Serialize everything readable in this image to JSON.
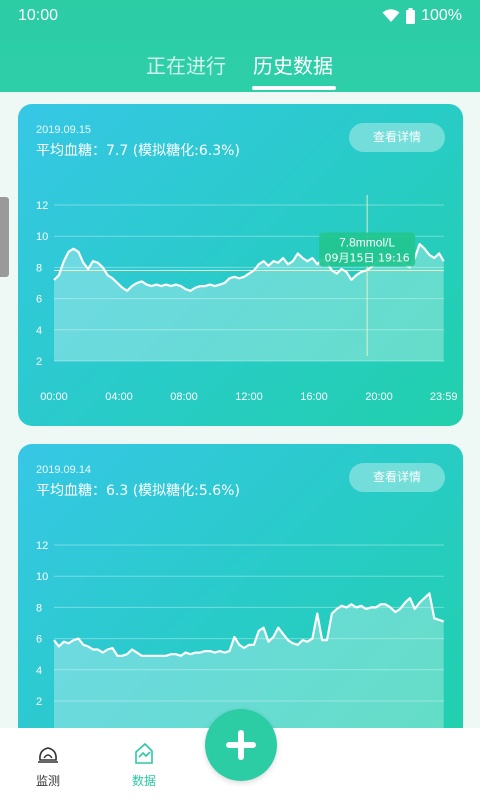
{
  "status": {
    "time": "10:00",
    "battery": "100%"
  },
  "tabs": [
    {
      "label": "正在进行",
      "active": false
    },
    {
      "label": "历史数据",
      "active": true
    }
  ],
  "colors": {
    "brand": "#2ccca5",
    "card_start": "#37c7e6",
    "card_end": "#21d0ac"
  },
  "cards": [
    {
      "date": "2019.09.15",
      "average": "平均血糖：7.7 (模拟糖化:6.3%)",
      "detail_button": "查看详情"
    },
    {
      "date": "2019.09.14",
      "average": "平均血糖：6.3 (模拟糖化:5.6%)",
      "detail_button": "查看详情"
    }
  ],
  "chart_data": [
    {
      "type": "area",
      "yticks": [
        "12",
        "10",
        "8",
        "6",
        "4",
        "2"
      ],
      "ylim": [
        2,
        12
      ],
      "xticks": [
        "00:00",
        "04:00",
        "08:00",
        "12:00",
        "16:00",
        "20:00",
        "23:59"
      ],
      "grid": true,
      "tooltip": {
        "value": "7.8mmol/L",
        "time": "09月15日 19:16",
        "x_hour": 19.27,
        "y": 7.8
      },
      "series": [
        {
          "x": [
            0,
            0.3,
            0.6,
            0.9,
            1.2,
            1.5,
            1.8,
            2.1,
            2.4,
            2.7,
            3.0,
            3.3,
            3.6,
            3.9,
            4.2,
            4.5,
            4.8,
            5.1,
            5.4,
            5.7,
            6.0,
            6.3,
            6.6,
            6.9,
            7.2,
            7.5,
            7.8,
            8.1,
            8.4,
            8.7,
            9.0,
            9.3,
            9.6,
            9.9,
            10.2,
            10.5,
            10.8,
            11.1,
            11.4,
            11.7,
            12.0,
            12.3,
            12.6,
            12.9,
            13.2,
            13.5,
            13.8,
            14.1,
            14.4,
            14.7,
            15.0,
            15.3,
            15.6,
            15.9,
            16.2,
            16.5,
            16.8,
            17.1,
            17.4,
            17.7,
            18.0,
            18.3,
            18.6,
            18.9,
            19.2,
            19.5,
            19.8,
            20.1,
            20.4,
            20.7,
            21.0,
            21.3,
            21.6,
            21.9,
            22.2,
            22.5,
            22.8,
            23.1,
            23.4,
            23.7,
            23.98
          ],
          "y": [
            7.2,
            7.5,
            8.4,
            9.0,
            9.2,
            9.0,
            8.3,
            7.9,
            8.4,
            8.3,
            8.0,
            7.5,
            7.3,
            7.0,
            6.7,
            6.5,
            6.8,
            7.0,
            7.1,
            6.9,
            6.8,
            6.9,
            6.8,
            6.9,
            6.8,
            6.9,
            6.8,
            6.6,
            6.5,
            6.7,
            6.8,
            6.8,
            6.9,
            6.8,
            6.9,
            7.0,
            7.3,
            7.4,
            7.3,
            7.4,
            7.6,
            7.8,
            8.2,
            8.4,
            8.1,
            8.4,
            8.3,
            8.6,
            8.2,
            8.4,
            8.9,
            8.6,
            8.4,
            8.6,
            8.2,
            8.5,
            8.3,
            7.8,
            7.6,
            7.9,
            7.7,
            7.2,
            7.5,
            7.7,
            7.8,
            8.0,
            8.3,
            8.6,
            8.4,
            8.8,
            8.3,
            8.7,
            8.2,
            8.0,
            8.6,
            9.5,
            9.2,
            8.8,
            8.6,
            8.9,
            8.4
          ]
        }
      ]
    },
    {
      "type": "area",
      "yticks": [
        "12",
        "10",
        "8",
        "6",
        "4",
        "2"
      ],
      "ylim": [
        2,
        12
      ],
      "grid": true,
      "series": [
        {
          "x": [
            0,
            0.3,
            0.6,
            0.9,
            1.2,
            1.5,
            1.8,
            2.1,
            2.4,
            2.7,
            3.0,
            3.3,
            3.6,
            3.9,
            4.2,
            4.5,
            4.8,
            5.1,
            5.4,
            5.7,
            6.0,
            6.3,
            6.6,
            6.9,
            7.2,
            7.5,
            7.8,
            8.1,
            8.4,
            8.7,
            9.0,
            9.3,
            9.6,
            9.9,
            10.2,
            10.5,
            10.8,
            11.1,
            11.4,
            11.7,
            12.0,
            12.3,
            12.6,
            12.9,
            13.2,
            13.5,
            13.8,
            14.1,
            14.4,
            14.7,
            15.0,
            15.3,
            15.6,
            15.9,
            16.2,
            16.5,
            16.8,
            17.1,
            17.4,
            17.7,
            18.0,
            18.3,
            18.6,
            18.9,
            19.2,
            19.5,
            19.8,
            20.1,
            20.4,
            20.7,
            21.0,
            21.3,
            21.6,
            21.9,
            22.2,
            22.5,
            22.8,
            23.1,
            23.4,
            23.7,
            23.98
          ],
          "y": [
            5.9,
            5.5,
            5.8,
            5.7,
            5.9,
            6.0,
            5.6,
            5.5,
            5.3,
            5.3,
            5.1,
            5.3,
            5.4,
            4.9,
            4.9,
            5.0,
            5.3,
            5.1,
            4.9,
            4.9,
            4.9,
            4.9,
            4.9,
            4.9,
            5.0,
            5.0,
            4.9,
            5.1,
            5.0,
            5.1,
            5.1,
            5.2,
            5.2,
            5.1,
            5.2,
            5.1,
            5.2,
            6.1,
            5.6,
            5.4,
            5.6,
            5.6,
            6.5,
            6.7,
            5.8,
            6.1,
            6.7,
            6.3,
            5.9,
            5.7,
            5.6,
            5.9,
            5.8,
            6.0,
            7.6,
            5.9,
            5.9,
            7.6,
            7.9,
            8.1,
            8.0,
            8.2,
            8.0,
            8.1,
            7.9,
            8.0,
            8.0,
            8.2,
            8.2,
            8.0,
            7.7,
            7.9,
            8.3,
            8.6,
            7.9,
            8.3,
            8.6,
            8.9,
            7.3,
            7.2,
            7.1
          ]
        }
      ]
    }
  ],
  "nav": {
    "items": [
      {
        "label": "监测",
        "active": false,
        "icon": "monitor-icon"
      },
      {
        "label": "数据",
        "active": true,
        "icon": "data-icon"
      }
    ],
    "fab_icon": "plus-icon"
  }
}
